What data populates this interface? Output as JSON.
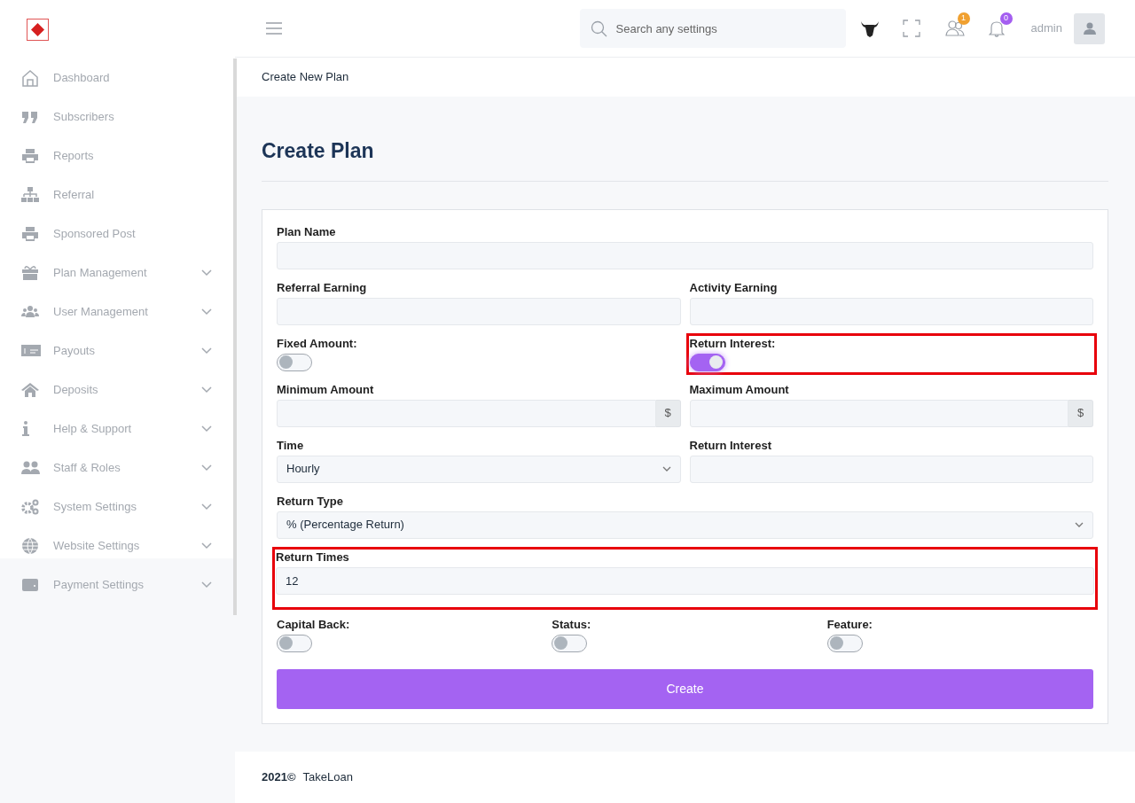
{
  "header": {
    "search": {
      "placeholder": "Search any settings"
    },
    "friends_badge": "1",
    "notifications_badge": "0",
    "user": "admin"
  },
  "sidebar": {
    "items": [
      {
        "label": "Dashboard",
        "expandable": false
      },
      {
        "label": "Subscribers",
        "expandable": false
      },
      {
        "label": "Reports",
        "expandable": false
      },
      {
        "label": "Referral",
        "expandable": false
      },
      {
        "label": "Sponsored Post",
        "expandable": false
      },
      {
        "label": "Plan Management",
        "expandable": true
      },
      {
        "label": "User Management",
        "expandable": true
      },
      {
        "label": "Payouts",
        "expandable": true
      },
      {
        "label": "Deposits",
        "expandable": true
      },
      {
        "label": "Help & Support",
        "expandable": true
      },
      {
        "label": "Staff & Roles",
        "expandable": true
      },
      {
        "label": "System Settings",
        "expandable": true
      },
      {
        "label": "Website Settings",
        "expandable": true
      },
      {
        "label": "Payment Settings",
        "expandable": true
      }
    ]
  },
  "breadcrumb": "Create New Plan",
  "title": "Create Plan",
  "form": {
    "rows": [
      [
        {
          "kind": "text",
          "label": "Plan Name",
          "highlighted": false
        }
      ],
      [
        {
          "kind": "text",
          "label": "Referral Earning",
          "highlighted": false
        },
        {
          "kind": "text",
          "label": "Activity Earning",
          "highlighted": false
        }
      ],
      [
        {
          "kind": "toggle",
          "label": "Fixed Amount:",
          "on": false,
          "highlighted": false
        },
        {
          "kind": "toggle",
          "label": "Return Interest:",
          "on": true,
          "highlighted": true
        }
      ],
      [
        {
          "kind": "addon",
          "label": "Minimum Amount",
          "addon": "$",
          "highlighted": false
        },
        {
          "kind": "addon",
          "label": "Maximum Amount",
          "addon": "$",
          "highlighted": false
        }
      ],
      [
        {
          "kind": "select",
          "label": "Time",
          "value": "Hourly",
          "highlighted": false
        },
        {
          "kind": "text",
          "label": "Return Interest",
          "highlighted": false
        }
      ],
      [
        {
          "kind": "select",
          "label": "Return Type",
          "value": "% (Percentage Return)",
          "highlighted": false
        }
      ],
      [
        {
          "kind": "text",
          "label": "Return Times",
          "value": "12",
          "highlighted": true
        }
      ],
      [
        {
          "kind": "toggle",
          "label": "Capital Back:",
          "on": false,
          "highlighted": false
        },
        {
          "kind": "toggle",
          "label": "Status:",
          "on": false,
          "highlighted": false
        },
        {
          "kind": "toggle",
          "label": "Feature:",
          "on": false,
          "highlighted": false
        }
      ]
    ],
    "submit": "Create"
  },
  "footer": {
    "year": "2021©",
    "brand": "TakeLoan"
  }
}
